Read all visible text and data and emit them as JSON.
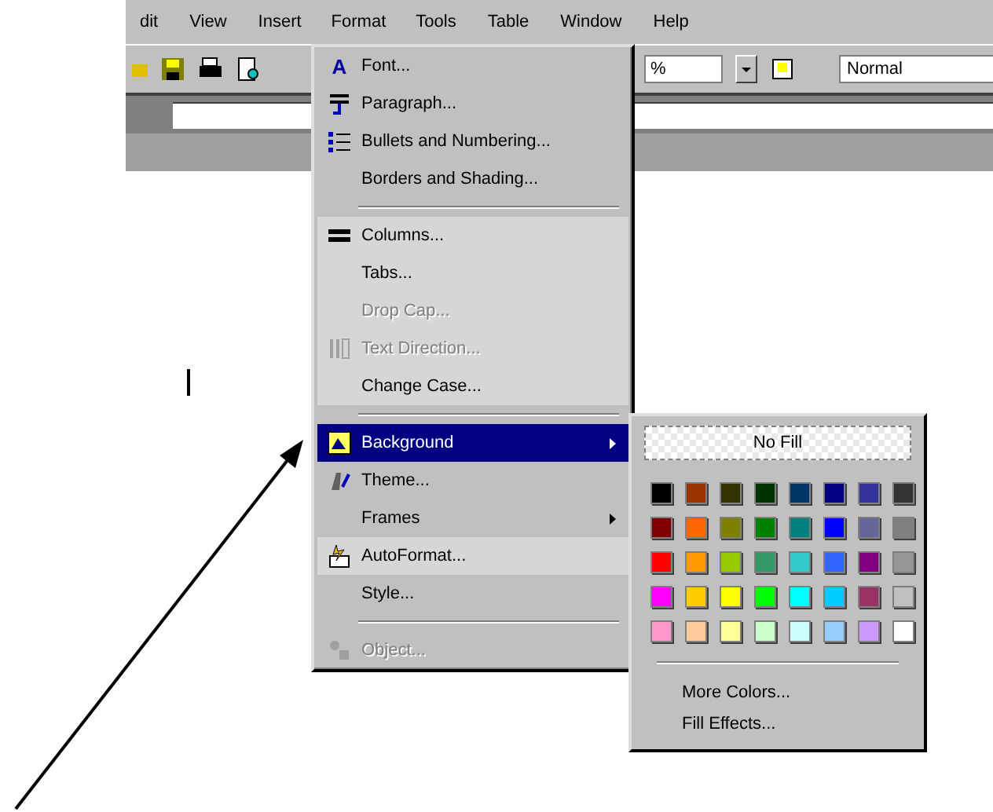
{
  "menu_bar": [
    {
      "label": "dit",
      "selected": false
    },
    {
      "label": "View",
      "selected": false
    },
    {
      "label": "Insert",
      "selected": false
    },
    {
      "label": "Format",
      "selected": true
    },
    {
      "label": "Tools",
      "selected": false
    },
    {
      "label": "Table",
      "selected": false
    },
    {
      "label": "Window",
      "selected": false
    },
    {
      "label": "Help",
      "selected": false
    }
  ],
  "toolbar": {
    "zoom": "%",
    "style": "Normal"
  },
  "format_menu": [
    {
      "kind": "item",
      "label": "Font...",
      "glyph": "A",
      "disabled": false,
      "selected": false,
      "submenu": false,
      "rarely_used": false
    },
    {
      "kind": "item",
      "label": "Paragraph...",
      "disabled": false,
      "selected": false,
      "submenu": false,
      "rarely_used": false
    },
    {
      "kind": "item",
      "label": "Bullets and Numbering...",
      "disabled": false,
      "selected": false,
      "submenu": false,
      "rarely_used": false
    },
    {
      "kind": "item",
      "label": "Borders and Shading...",
      "disabled": false,
      "selected": false,
      "submenu": false,
      "rarely_used": false
    },
    {
      "kind": "separator"
    },
    {
      "kind": "item",
      "label": "Columns...",
      "disabled": false,
      "selected": false,
      "submenu": false,
      "rarely_used": true
    },
    {
      "kind": "item",
      "label": "Tabs...",
      "disabled": false,
      "selected": false,
      "submenu": false,
      "rarely_used": true
    },
    {
      "kind": "item",
      "label": "Drop Cap...",
      "disabled": true,
      "selected": false,
      "submenu": false,
      "rarely_used": true
    },
    {
      "kind": "item",
      "label": "Text Direction...",
      "disabled": true,
      "selected": false,
      "submenu": false,
      "rarely_used": true
    },
    {
      "kind": "item",
      "label": "Change Case...",
      "disabled": false,
      "selected": false,
      "submenu": false,
      "rarely_used": true
    },
    {
      "kind": "separator"
    },
    {
      "kind": "item",
      "label": "Background",
      "disabled": false,
      "selected": true,
      "submenu": true,
      "rarely_used": false
    },
    {
      "kind": "item",
      "label": "Theme...",
      "disabled": false,
      "selected": false,
      "submenu": false,
      "rarely_used": false
    },
    {
      "kind": "item",
      "label": "Frames",
      "disabled": false,
      "selected": false,
      "submenu": true,
      "rarely_used": false
    },
    {
      "kind": "item",
      "label": "AutoFormat...",
      "disabled": false,
      "selected": false,
      "submenu": false,
      "rarely_used": true
    },
    {
      "kind": "item",
      "label": "Style...",
      "disabled": false,
      "selected": false,
      "submenu": false,
      "rarely_used": false
    },
    {
      "kind": "separator"
    },
    {
      "kind": "item",
      "label": "Object...",
      "disabled": true,
      "selected": false,
      "submenu": false,
      "rarely_used": false
    }
  ],
  "background_submenu": {
    "no_fill": "No Fill",
    "colors": [
      {
        "color": "#000000"
      },
      {
        "color": "#993300"
      },
      {
        "color": "#333300"
      },
      {
        "color": "#003300"
      },
      {
        "color": "#003366"
      },
      {
        "color": "#000080"
      },
      {
        "color": "#333399"
      },
      {
        "color": "#333333"
      },
      {
        "color": "#800000"
      },
      {
        "color": "#ff6600"
      },
      {
        "color": "#808000"
      },
      {
        "color": "#008000"
      },
      {
        "color": "#008080"
      },
      {
        "color": "#0000ff"
      },
      {
        "color": "#666699"
      },
      {
        "color": "#808080"
      },
      {
        "color": "#ff0000"
      },
      {
        "color": "#ff9900"
      },
      {
        "color": "#99cc00"
      },
      {
        "color": "#339966"
      },
      {
        "color": "#33cccc"
      },
      {
        "color": "#3366ff"
      },
      {
        "color": "#800080"
      },
      {
        "color": "#969696"
      },
      {
        "color": "#ff00ff"
      },
      {
        "color": "#ffcc00"
      },
      {
        "color": "#ffff00"
      },
      {
        "color": "#00ff00"
      },
      {
        "color": "#00ffff"
      },
      {
        "color": "#00ccff"
      },
      {
        "color": "#993366"
      },
      {
        "color": "#c0c0c0"
      },
      {
        "color": "#ff99cc"
      },
      {
        "color": "#ffcc99"
      },
      {
        "color": "#ffff99"
      },
      {
        "color": "#ccffcc"
      },
      {
        "color": "#ccffff"
      },
      {
        "color": "#99ccff"
      },
      {
        "color": "#cc99ff"
      },
      {
        "color": "#ffffff"
      }
    ],
    "buttons": [
      "More Colors...",
      "Fill Effects..."
    ]
  }
}
